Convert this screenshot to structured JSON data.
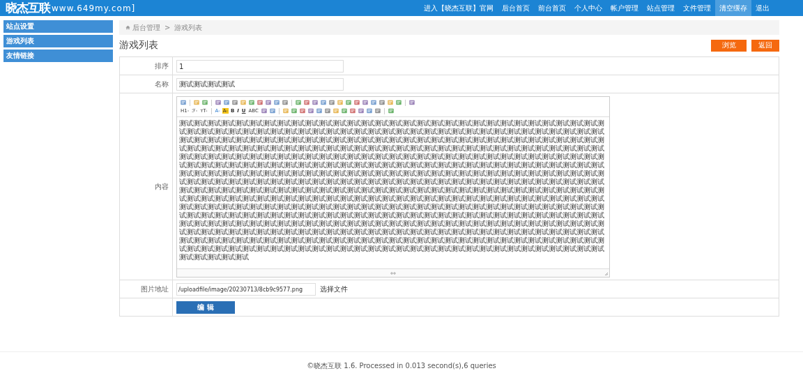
{
  "header": {
    "logo": "晓杰互联",
    "site": "www.649my.com]",
    "nav": [
      {
        "label": "进入【晓杰互联】官网",
        "selected": false
      },
      {
        "label": "后台首页",
        "selected": false
      },
      {
        "label": "前台首页",
        "selected": false
      },
      {
        "label": "个人中心",
        "selected": false
      },
      {
        "label": "帐户管理",
        "selected": false
      },
      {
        "label": "站点管理",
        "selected": false
      },
      {
        "label": "文件管理",
        "selected": false
      },
      {
        "label": "清空缓存",
        "selected": true
      },
      {
        "label": "退出",
        "selected": false
      }
    ]
  },
  "sidebar": {
    "items": [
      {
        "label": "站点设置",
        "selected": false
      },
      {
        "label": "游戏列表",
        "selected": false
      },
      {
        "label": "友情链接",
        "selected": false
      }
    ]
  },
  "breadcrumb": [
    "后台管理",
    ">",
    "游戏列表"
  ],
  "page_title": "游戏列表",
  "actions": [
    {
      "label": "浏览"
    },
    {
      "label": "返回"
    }
  ],
  "form": {
    "rows": [
      {
        "kind": "input",
        "label": "排序",
        "value": "1"
      },
      {
        "kind": "input",
        "label": "名称",
        "value": "测试测试测试测试"
      },
      {
        "kind": "editor",
        "label": "内容",
        "toolbar": [
          [
            {
              "kind": "icon"
            },
            {
              "kind": "sep"
            },
            {
              "kind": "icon"
            },
            {
              "kind": "icon"
            },
            {
              "kind": "sep"
            },
            {
              "kind": "icon"
            },
            {
              "kind": "icon"
            },
            {
              "kind": "icon"
            },
            {
              "kind": "icon"
            },
            {
              "kind": "icon"
            },
            {
              "kind": "icon"
            },
            {
              "kind": "icon"
            },
            {
              "kind": "icon"
            },
            {
              "kind": "icon"
            },
            {
              "kind": "sep"
            },
            {
              "kind": "icon"
            },
            {
              "kind": "icon"
            },
            {
              "kind": "icon"
            },
            {
              "kind": "icon"
            },
            {
              "kind": "icon"
            },
            {
              "kind": "icon"
            },
            {
              "kind": "icon"
            },
            {
              "kind": "icon"
            },
            {
              "kind": "icon"
            },
            {
              "kind": "icon"
            },
            {
              "kind": "icon"
            },
            {
              "kind": "icon"
            },
            {
              "kind": "icon"
            },
            {
              "kind": "sep"
            },
            {
              "kind": "icon"
            }
          ],
          [
            {
              "kind": "text",
              "label": "H1-"
            },
            {
              "kind": "text",
              "label": "ℱ-"
            },
            {
              "kind": "text",
              "label": "тT-"
            },
            {
              "kind": "sep"
            },
            {
              "kind": "text",
              "label": "A-"
            },
            {
              "kind": "text",
              "label": "A-"
            },
            {
              "kind": "text",
              "label": "B"
            },
            {
              "kind": "text",
              "label": "I"
            },
            {
              "kind": "text",
              "label": "U"
            },
            {
              "kind": "text",
              "label": "ABC"
            },
            {
              "kind": "icon"
            },
            {
              "kind": "icon"
            },
            {
              "kind": "sep"
            },
            {
              "kind": "icon"
            },
            {
              "kind": "icon"
            },
            {
              "kind": "icon"
            },
            {
              "kind": "icon"
            },
            {
              "kind": "icon"
            },
            {
              "kind": "icon"
            },
            {
              "kind": "icon"
            },
            {
              "kind": "icon"
            },
            {
              "kind": "icon"
            },
            {
              "kind": "icon"
            },
            {
              "kind": "icon"
            },
            {
              "kind": "icon"
            },
            {
              "kind": "sep"
            },
            {
              "kind": "icon"
            }
          ]
        ],
        "content": "测试测试测试测试测试测试测试测试测试测试测试测试测试测试测试测试测试测试测试测试测试测试测试测试测试测试测试测试测试测试测试测试测试测试测试测试测试测试测试测试测试测试测试测试测试测试测试测试测试测试测试测试测试测试测试测试测试测试测试测试测试测试测试测试测试测试测试测试测试测试测试测试测试测试测试测试测试测试测试测试测试测试测试测试测试测试测试测试测试测试测试测试测试测试测试测试测试测试测试测试测试测试测试测试测试测试测试测试测试测试测试测试测试测试测试测试测试测试测试测试测试测试测试测试测试测试测试测试测试测试测试测试测试测试测试测试测试测试测试测试测试测试测试测试测试测试测试测试测试测试测试测试测试测试测试测试测试测试测试测试测试测试测试测试测试测试测试测试测试测试测试测试测试测试测试测试测试测试测试测试测试测试测试测试测试测试测试测试测试测试测试测试测试测试测试测试测试测试测试测试测试测试测试测试测试测试测试测试测试测试测试测试测试测试测试测试测试测试测试测试测试测试测试测试测试测试测试测试测试测试测试测试测试测试测试测试测试测试测试测试测试测试测试测试测试测试测试测试测试测试测试测试测试测试测试测试测试测试测试测试测试测试测试测试测试测试测试测试测试测试测试测试测试测试测试测试测试测试测试测试测试测试测试测试测试测试测试测试测试测试测试测试测试测试测试测试测试测试测试测试测试测试测试测试测试测试测试测试测试测试测试测试测试测试测试测试测试测试测试测试测试测试测试测试测试测试测试测试测试测试测试测试测试测试测试测试测试测试测试测试测试测试测试测试测试测试测试测试测试测试测试测试测试测试测试测试测试测试测试测试测试测试测试测试测试测试测试测试测试测试测试测试测试测试测试测试测试测试测试测试测试测试测试测试测试测试测试测试测试测试测试测试测试测试测试测试测试测试测试测试测试测试测试测试测试测试测试测试测试测试测试测试测试测试测试测试测试测试测试测试测试测试测试测试测试测试测试测试测试测试测试测试测试测试测试测试测试测试测试测试测试测试测试测试测试测试测试测试测试测试测试测试测试测试测试测试测试测试测试测试测试测试测试测试测试测试测试测试测试测试测试测试测试测试测试测试测试测试测试测试测试测试测试测试测试测试测试测试测试测试测试测试测试"
      },
      {
        "kind": "file",
        "label": "图片地址",
        "value": "/uploadfile/image/20230713/8cb9c9577.png",
        "button": "选择文件"
      },
      {
        "kind": "submit",
        "button": "编 辑"
      }
    ]
  },
  "footer": "©晓杰互联 1.6. Processed in 0.013 second(s),6 queries"
}
